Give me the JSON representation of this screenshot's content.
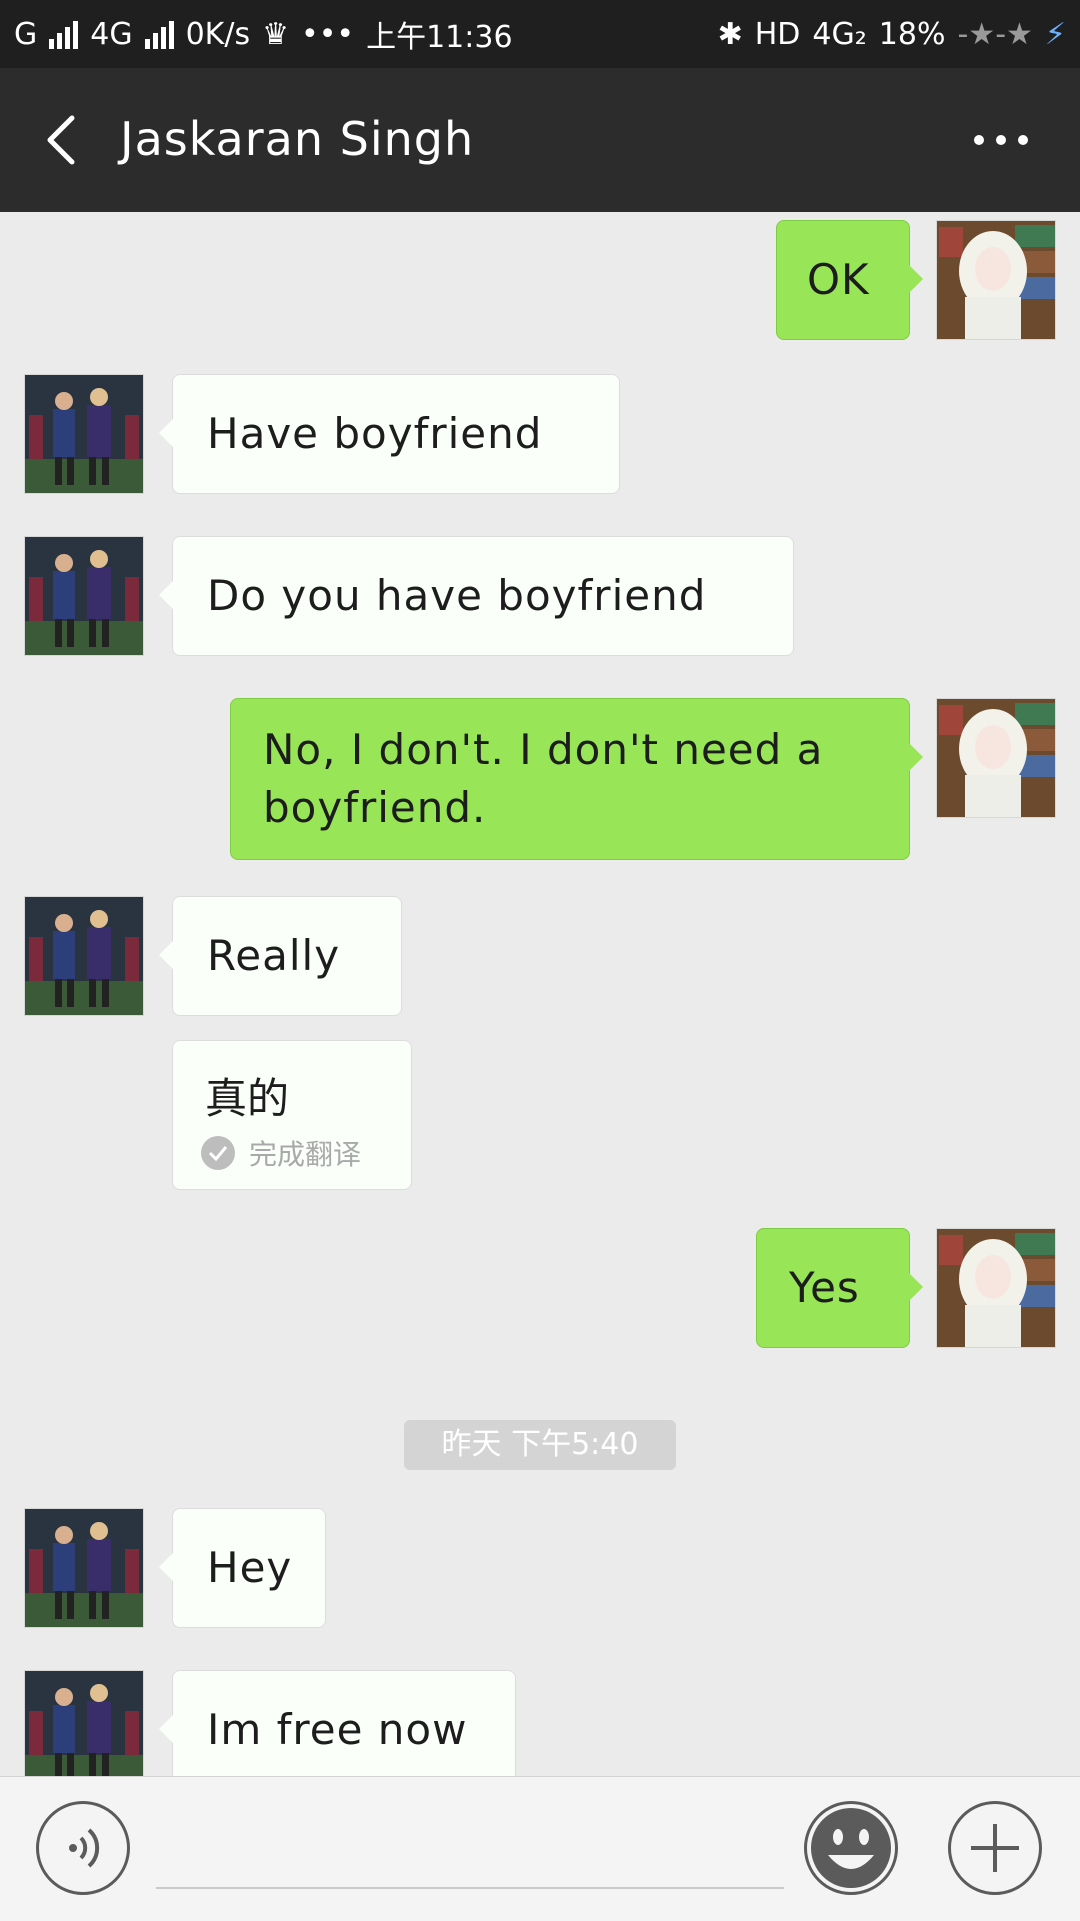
{
  "status_bar": {
    "carrier_1": "G",
    "carrier_2": "4G",
    "speed": "0K/s",
    "more_dots": "•••",
    "time": "上午11:36",
    "hd": "HD",
    "network": "4G₂",
    "battery": "18%"
  },
  "header": {
    "title": "Jaskaran Singh"
  },
  "messages": [
    {
      "side": "me",
      "text": "OK"
    },
    {
      "side": "other",
      "text": "Have boyfriend"
    },
    {
      "side": "other",
      "text": "Do you have boyfriend"
    },
    {
      "side": "me",
      "text": "No, I don't. I don't need a boyfriend."
    },
    {
      "side": "other",
      "text": "Really"
    },
    {
      "side": "me",
      "text": "Yes"
    },
    {
      "side": "other",
      "text": "Hey"
    },
    {
      "side": "other",
      "text": "Im free now"
    }
  ],
  "translation": {
    "text": "真的",
    "status": "完成翻译"
  },
  "timestamp": "昨天 下午5:40",
  "input": {
    "placeholder": ""
  },
  "colors": {
    "my_bubble": "#98e658",
    "other_bubble": "#fafffa",
    "header_bg": "#2c2c2c",
    "chat_bg": "#ebebeb"
  }
}
